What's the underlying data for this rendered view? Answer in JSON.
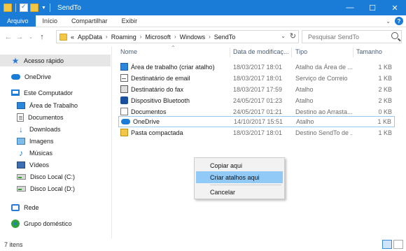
{
  "window": {
    "title": "SendTo"
  },
  "ribbon": {
    "tabs": [
      "Arquivo",
      "Início",
      "Compartilhar",
      "Exibir"
    ]
  },
  "address": {
    "overflow": "«",
    "crumbs": [
      "AppData",
      "Roaming",
      "Microsoft",
      "Windows",
      "SendTo"
    ]
  },
  "search": {
    "placeholder": "Pesquisar SendTo"
  },
  "sidebar": {
    "items": [
      {
        "label": "Acesso rápido",
        "icon": "star-icon"
      },
      {
        "label": "OneDrive",
        "icon": "cloud-icon"
      },
      {
        "label": "Este Computador",
        "icon": "computer-icon"
      },
      {
        "label": "Área de Trabalho",
        "icon": "desktop-icon"
      },
      {
        "label": "Documentos",
        "icon": "documents-icon"
      },
      {
        "label": "Downloads",
        "icon": "download-icon"
      },
      {
        "label": "Imagens",
        "icon": "pictures-icon"
      },
      {
        "label": "Músicas",
        "icon": "music-icon"
      },
      {
        "label": "Vídeos",
        "icon": "videos-icon"
      },
      {
        "label": "Disco Local (C:)",
        "icon": "drive-icon"
      },
      {
        "label": "Disco Local (D:)",
        "icon": "drive-icon"
      },
      {
        "label": "Rede",
        "icon": "network-icon"
      },
      {
        "label": "Grupo doméstico",
        "icon": "homegroup-icon"
      }
    ]
  },
  "columns": {
    "name": "Nome",
    "date": "Data de modificaç...",
    "type": "Tipo",
    "size": "Tamanho"
  },
  "files": [
    {
      "name": "Área de trabalho (criar atalho)",
      "date": "18/03/2017 18:01",
      "type": "Atalho da Área de ...",
      "size": "1 KB",
      "icon": "desktop-shortcut-icon"
    },
    {
      "name": "Destinatário de email",
      "date": "18/03/2017 18:01",
      "type": "Serviço de Correio",
      "size": "1 KB",
      "icon": "mail-icon"
    },
    {
      "name": "Destinatário do fax",
      "date": "18/03/2017 17:59",
      "type": "Atalho",
      "size": "2 KB",
      "icon": "fax-icon"
    },
    {
      "name": "Dispositivo Bluetooth",
      "date": "24/05/2017 01:23",
      "type": "Atalho",
      "size": "2 KB",
      "icon": "bluetooth-icon"
    },
    {
      "name": "Documentos",
      "date": "24/05/2017 01:21",
      "type": "Destino ao Arrasta...",
      "size": "0 KB",
      "icon": "documents-icon"
    },
    {
      "name": "OneDrive",
      "date": "14/10/2017 15:51",
      "type": "Atalho",
      "size": "1 KB",
      "icon": "cloud-icon"
    },
    {
      "name": "Pasta compactada",
      "date": "18/03/2017 18:01",
      "type": "Destino SendTo de ...",
      "size": "1 KB",
      "icon": "zip-folder-icon"
    }
  ],
  "context_menu": {
    "items": [
      "Copiar aqui",
      "Criar atalhos aqui",
      "Cancelar"
    ],
    "highlighted": "Criar atalhos aqui"
  },
  "status": {
    "count": "7 itens"
  },
  "colors": {
    "accent": "#1a7cd6",
    "selection": "#91c9f7"
  }
}
